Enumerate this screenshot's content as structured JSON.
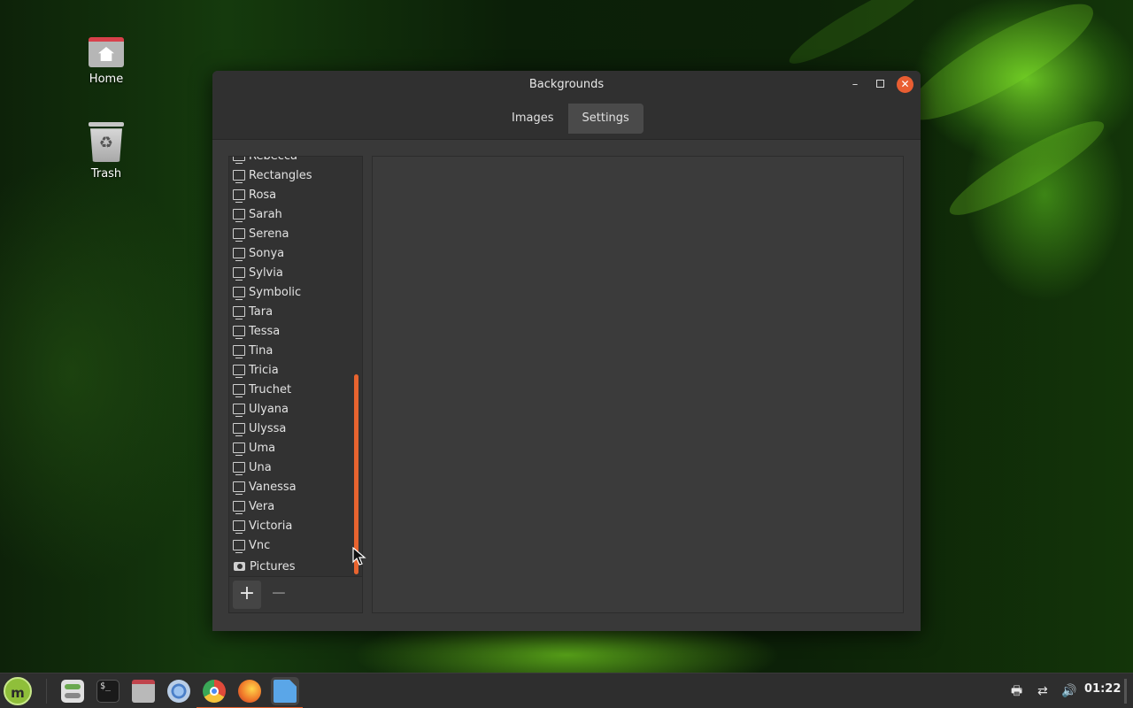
{
  "desktop": {
    "icons": [
      {
        "label": "Home",
        "icon": "home-folder-icon"
      },
      {
        "label": "Trash",
        "icon": "trash-icon"
      }
    ]
  },
  "window": {
    "title": "Backgrounds",
    "controls": {
      "minimize": "–",
      "maximize": "□",
      "close": "×"
    },
    "tabs": [
      {
        "label": "Images",
        "active": false
      },
      {
        "label": "Settings",
        "active": true
      }
    ],
    "collections": [
      {
        "label": "Rebecca",
        "icon": "monitor-icon"
      },
      {
        "label": "Rectangles",
        "icon": "monitor-icon"
      },
      {
        "label": "Rosa",
        "icon": "monitor-icon"
      },
      {
        "label": "Sarah",
        "icon": "monitor-icon"
      },
      {
        "label": "Serena",
        "icon": "monitor-icon"
      },
      {
        "label": "Sonya",
        "icon": "monitor-icon"
      },
      {
        "label": "Sylvia",
        "icon": "monitor-icon"
      },
      {
        "label": "Symbolic",
        "icon": "monitor-icon"
      },
      {
        "label": "Tara",
        "icon": "monitor-icon"
      },
      {
        "label": "Tessa",
        "icon": "monitor-icon"
      },
      {
        "label": "Tina",
        "icon": "monitor-icon"
      },
      {
        "label": "Tricia",
        "icon": "monitor-icon"
      },
      {
        "label": "Truchet",
        "icon": "monitor-icon"
      },
      {
        "label": "Ulyana",
        "icon": "monitor-icon"
      },
      {
        "label": "Ulyssa",
        "icon": "monitor-icon"
      },
      {
        "label": "Uma",
        "icon": "monitor-icon"
      },
      {
        "label": "Una",
        "icon": "monitor-icon"
      },
      {
        "label": "Vanessa",
        "icon": "monitor-icon"
      },
      {
        "label": "Vera",
        "icon": "monitor-icon"
      },
      {
        "label": "Victoria",
        "icon": "monitor-icon"
      },
      {
        "label": "Vnc",
        "icon": "monitor-icon"
      },
      {
        "label": "Pictures",
        "icon": "camera-icon"
      }
    ],
    "list_toolbar": {
      "add": "+",
      "remove": "−"
    }
  },
  "taskbar": {
    "menu_label": "m",
    "launchers": [
      {
        "name": "settings-launcher",
        "icon": "toggle-icon",
        "color": "#dcdcdc"
      },
      {
        "name": "terminal-launcher",
        "icon": "terminal-icon",
        "color": "#1e1e1e"
      },
      {
        "name": "files-launcher",
        "icon": "folder-icon",
        "color": "#c0444c"
      },
      {
        "name": "chromium-launcher",
        "icon": "chromium-icon",
        "color": "#6a9ad8"
      },
      {
        "name": "chrome-launcher",
        "icon": "chrome-icon",
        "color": "#e04a3a"
      },
      {
        "name": "firefox-launcher",
        "icon": "firefox-icon",
        "color": "#f07a2a"
      },
      {
        "name": "backgrounds-launcher",
        "icon": "document-icon",
        "color": "#5aa6e8"
      }
    ],
    "tray": {
      "printer": "printer-icon",
      "network": "network-disconnected-icon",
      "volume": "volume-icon",
      "clock": "01:22"
    }
  },
  "colors": {
    "accent": "#e8642f",
    "close": "#e95e32",
    "mint": "#8fbf3a"
  }
}
